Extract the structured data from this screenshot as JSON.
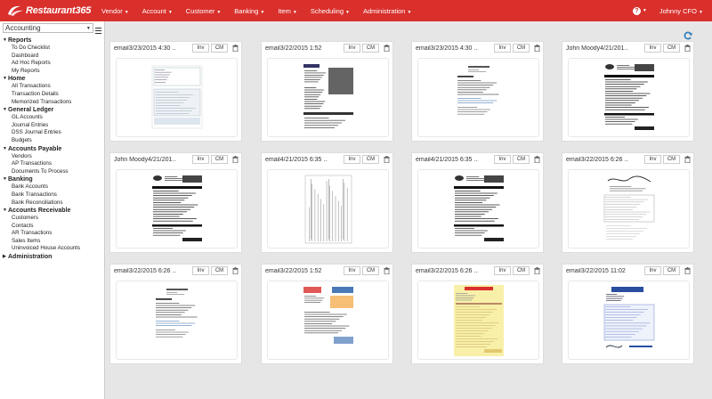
{
  "app": {
    "brand": "Restaurant365",
    "nav": [
      {
        "label": "Vendor"
      },
      {
        "label": "Account"
      },
      {
        "label": "Customer"
      },
      {
        "label": "Banking"
      },
      {
        "label": "Item"
      },
      {
        "label": "Scheduling"
      },
      {
        "label": "Administration"
      }
    ],
    "help_icon": "question-circle-icon",
    "user": "Johnny CFO",
    "colors": {
      "navbar": "#d9302c",
      "content_bg": "#e6e6e6"
    }
  },
  "sidebar": {
    "module": "Accounting",
    "sections": [
      {
        "label": "Reports",
        "expanded": true,
        "items": [
          "To Do Checklist",
          "Dashboard",
          "Ad Hoc Reports",
          "My Reports"
        ]
      },
      {
        "label": "Home",
        "expanded": true,
        "items": [
          "All Transactions",
          "Transaction Details",
          "Memorized Transactions"
        ]
      },
      {
        "label": "General Ledger",
        "expanded": true,
        "items": [
          "GL Accounts",
          "Journal Entries",
          "DSS Journal Entries",
          "Budgets"
        ]
      },
      {
        "label": "Accounts Payable",
        "expanded": true,
        "items": [
          "Vendors",
          "AP Transactions",
          "Documents To Process"
        ]
      },
      {
        "label": "Banking",
        "expanded": true,
        "items": [
          "Bank Accounts",
          "Bank Transactions",
          "Bank Reconciliations"
        ]
      },
      {
        "label": "Accounts Receivable",
        "expanded": true,
        "items": [
          "Customers",
          "Contacts",
          "AR Transactions",
          "Sales Items",
          "Uninvoiced House Accounts"
        ]
      },
      {
        "label": "Administration",
        "expanded": false,
        "items": []
      }
    ]
  },
  "documents": {
    "buttons": {
      "inv": "Inv",
      "cm": "CM"
    },
    "cards": [
      {
        "title": "email3/23/2015 4:30 ...",
        "doc_type": "form"
      },
      {
        "title": "email3/22/2015 1:52",
        "doc_type": "receipt"
      },
      {
        "title": "email3/23/2015 4:30 ...",
        "doc_type": "letter"
      },
      {
        "title": "John Moody4/21/201...",
        "doc_type": "invoice-dark"
      },
      {
        "title": "John Moody4/21/201...",
        "doc_type": "invoice-dark"
      },
      {
        "title": "email4/21/2015 6:35 ...",
        "doc_type": "rotated"
      },
      {
        "title": "email4/21/2015 6:35 ...",
        "doc_type": "invoice-dark"
      },
      {
        "title": "email3/22/2015 6:26 ...",
        "doc_type": "handwritten"
      },
      {
        "title": "email3/22/2015 6:26 ...",
        "doc_type": "letter"
      },
      {
        "title": "email3/22/2015 1:52",
        "doc_type": "colored"
      },
      {
        "title": "email3/22/2015 6:26 ...",
        "doc_type": "yellow"
      },
      {
        "title": "email3/22/2015 11:02",
        "doc_type": "blue-form"
      }
    ]
  }
}
